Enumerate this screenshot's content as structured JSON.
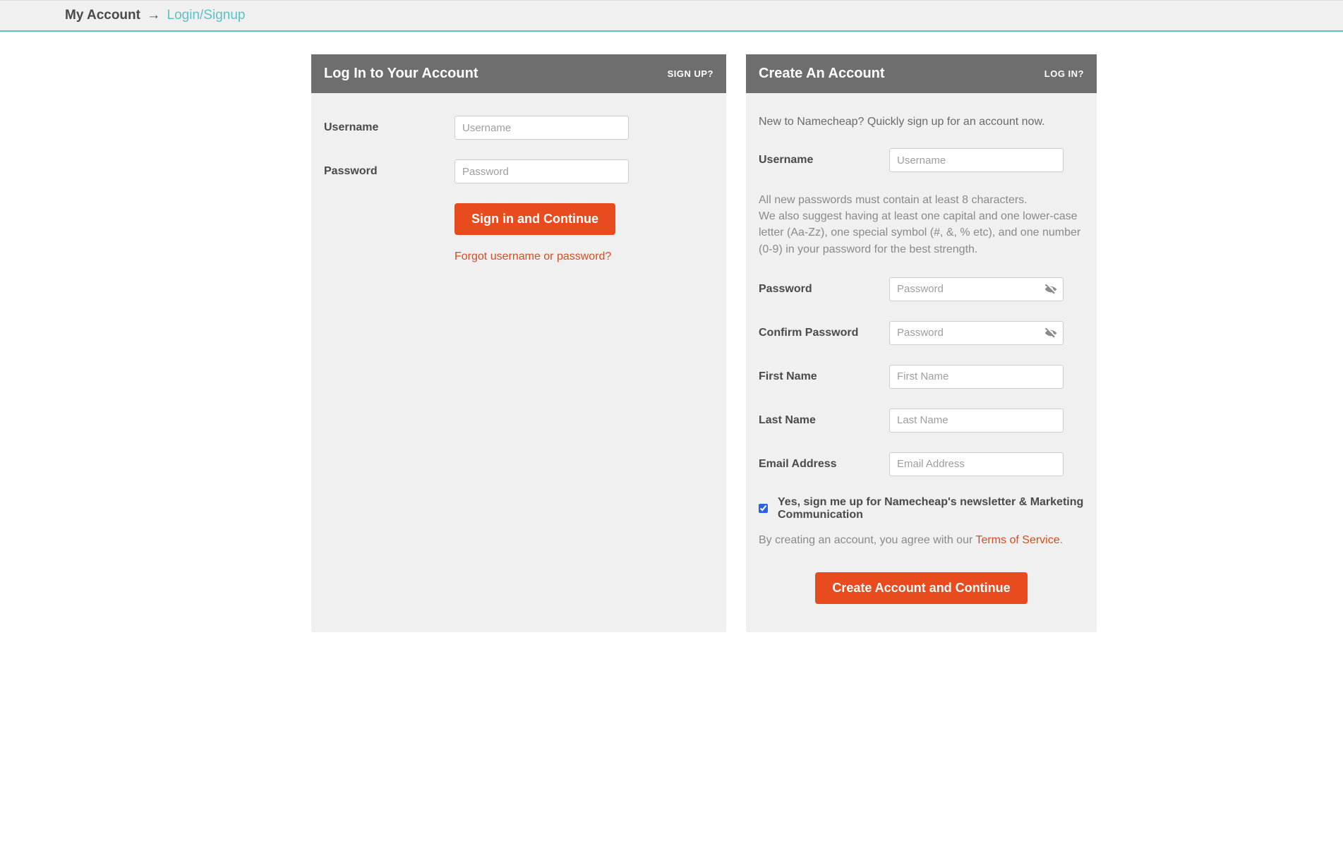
{
  "breadcrumb": {
    "root": "My Account",
    "arrow": "→",
    "current": "Login/Signup"
  },
  "login": {
    "title": "Log In to Your Account",
    "headerLink": "SIGN UP?",
    "usernameLabel": "Username",
    "usernamePlaceholder": "Username",
    "passwordLabel": "Password",
    "passwordPlaceholder": "Password",
    "submit": "Sign in and Continue",
    "forgot": "Forgot username or password?"
  },
  "signup": {
    "title": "Create An Account",
    "headerLink": "LOG IN?",
    "intro": "New to Namecheap? Quickly sign up for an account now.",
    "usernameLabel": "Username",
    "usernamePlaceholder": "Username",
    "passwordHint": "All new passwords must contain at least 8 characters.\nWe also suggest having at least one capital and one lower-case letter (Aa-Zz), one special symbol (#, &, % etc), and one number (0-9) in your password for the best strength.",
    "passwordLabel": "Password",
    "passwordPlaceholder": "Password",
    "confirmLabel": "Confirm Password",
    "confirmPlaceholder": "Password",
    "firstNameLabel": "First Name",
    "firstNamePlaceholder": "First Name",
    "lastNameLabel": "Last Name",
    "lastNamePlaceholder": "Last Name",
    "emailLabel": "Email Address",
    "emailPlaceholder": "Email Address",
    "newsletterLabel": "Yes, sign me up for Namecheap's newsletter & Marketing Communication",
    "tosPrefix": "By creating an account, you agree with our ",
    "tosLink": "Terms of Service",
    "tosSuffix": ".",
    "submit": "Create Account and Continue"
  }
}
